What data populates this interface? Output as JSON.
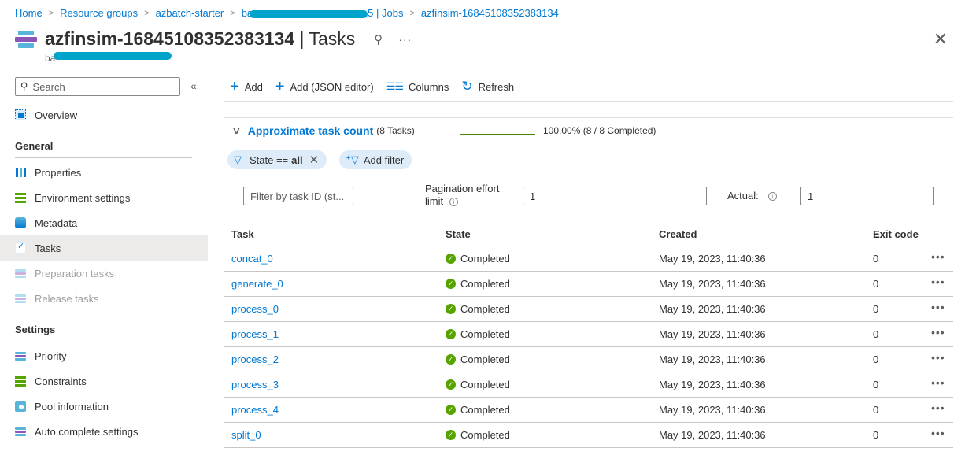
{
  "breadcrumb": [
    {
      "label": "Home"
    },
    {
      "label": "Resource groups"
    },
    {
      "label": "azbatch-starter"
    },
    {
      "label_prefix": "ba",
      "label_suffix": "5 | Jobs"
    },
    {
      "label": "azfinsim-16845108352383134"
    }
  ],
  "header": {
    "title_bold": "azfinsim-16845108352383134",
    "title_light": " | Tasks",
    "subtitle_prefix": "ba",
    "pin_icon": "pin-icon",
    "more_label": "···",
    "close_label": "✕"
  },
  "sidebar": {
    "search_placeholder": "Search",
    "collapse_label": "«",
    "overview": "Overview",
    "sections": [
      {
        "title": "General",
        "items": [
          {
            "label": "Properties",
            "icon": "properties-icon"
          },
          {
            "label": "Environment settings",
            "icon": "environment-settings-icon"
          },
          {
            "label": "Metadata",
            "icon": "metadata-icon"
          },
          {
            "label": "Tasks",
            "icon": "tasks-icon",
            "active": true
          },
          {
            "label": "Preparation tasks",
            "icon": "preparation-tasks-icon",
            "disabled": true
          },
          {
            "label": "Release tasks",
            "icon": "release-tasks-icon",
            "disabled": true
          }
        ]
      },
      {
        "title": "Settings",
        "items": [
          {
            "label": "Priority",
            "icon": "priority-icon"
          },
          {
            "label": "Constraints",
            "icon": "constraints-icon"
          },
          {
            "label": "Pool information",
            "icon": "pool-information-icon"
          },
          {
            "label": "Auto complete settings",
            "icon": "auto-complete-settings-icon"
          }
        ]
      }
    ]
  },
  "toolbar": {
    "add": "Add",
    "add_json": "Add (JSON editor)",
    "columns": "Columns",
    "refresh": "Refresh"
  },
  "task_count": {
    "title": "Approximate task count",
    "subtitle": "(8 Tasks)",
    "progress_fraction": 1.0,
    "progress_text": "100.00% (8 / 8 Completed)",
    "progress_color": "#498205"
  },
  "filters": {
    "state_label": "State ==",
    "state_value": "all",
    "add_filter": "Add filter"
  },
  "inputs": {
    "task_filter_placeholder": "Filter by task ID (st...",
    "pagination_label_1": "Pagination effort",
    "pagination_label_2": "limit",
    "pagination_value": "1",
    "actual_label": "Actual:",
    "actual_value": "1"
  },
  "table": {
    "columns": [
      "Task",
      "State",
      "Created",
      "Exit code"
    ],
    "rows": [
      {
        "task": "concat_0",
        "state": "Completed",
        "created": "May 19, 2023, 11:40:36",
        "exit_code": "0"
      },
      {
        "task": "generate_0",
        "state": "Completed",
        "created": "May 19, 2023, 11:40:36",
        "exit_code": "0"
      },
      {
        "task": "process_0",
        "state": "Completed",
        "created": "May 19, 2023, 11:40:36",
        "exit_code": "0"
      },
      {
        "task": "process_1",
        "state": "Completed",
        "created": "May 19, 2023, 11:40:36",
        "exit_code": "0"
      },
      {
        "task": "process_2",
        "state": "Completed",
        "created": "May 19, 2023, 11:40:36",
        "exit_code": "0"
      },
      {
        "task": "process_3",
        "state": "Completed",
        "created": "May 19, 2023, 11:40:36",
        "exit_code": "0"
      },
      {
        "task": "process_4",
        "state": "Completed",
        "created": "May 19, 2023, 11:40:36",
        "exit_code": "0"
      },
      {
        "task": "split_0",
        "state": "Completed",
        "created": "May 19, 2023, 11:40:36",
        "exit_code": "0"
      }
    ],
    "row_more_label": "•••"
  },
  "colors": {
    "accent": "#0078d4",
    "success": "#57a300",
    "redaction": "#00a3c9"
  }
}
